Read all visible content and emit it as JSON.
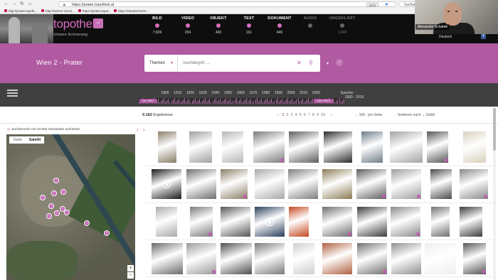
{
  "browser": {
    "url": "https://prater.topothek.at",
    "zoom": "110%",
    "search_placeholder": "Suchen",
    "bookmarks": [
      "http://prater.topoth...",
      "http://wiener-neust...",
      "https://prater.topot...",
      "https://haustechnen..."
    ]
  },
  "webcam": {
    "name": "Alexander Schatek"
  },
  "site": {
    "brand": "topothek",
    "tagline": "Unsere Erinnerung",
    "language": "Deutsch",
    "categories": [
      {
        "label": "BILD",
        "count": "7.826",
        "active": true
      },
      {
        "label": "VIDEO",
        "count": "254",
        "active": true
      },
      {
        "label": "OBJEKT",
        "count": "490",
        "active": true
      },
      {
        "label": "TEXT",
        "count": "161",
        "active": true
      },
      {
        "label": "DOKUMENT",
        "count": "449",
        "active": true
      },
      {
        "label": "AUDIO",
        "count": "-",
        "active": false
      },
      {
        "label": "UNGEKLÄRT",
        "count": "1.240",
        "active": false
      }
    ]
  },
  "search": {
    "district": "Wien 2 - Prater",
    "themen_label": "Themen",
    "placeholder": "Suchbegriff, ..."
  },
  "timeline": {
    "years": [
      "1900",
      "1910",
      "1920",
      "1930",
      "1940",
      "1950",
      "1960",
      "1970",
      "1980",
      "1990",
      "2000",
      "2010",
      "2020"
    ],
    "vor_label": "vor 1900",
    "nach_label": "nach 2019",
    "epoche_label": "Epoche:",
    "epoche_value": "1900 - 2019"
  },
  "results": {
    "count": "9.182",
    "count_label": "Ergebnisse",
    "pages": [
      "1",
      "2",
      "3",
      "4",
      "5",
      "6",
      "7",
      "8",
      "9",
      "10"
    ],
    "current_page": "1",
    "per_page": "100 · pro Seite",
    "sort": "Sortieren nach",
    "sort_value": "Zufall"
  },
  "map": {
    "hint": "Suchbereich mit rechter Maustaste aufziehen",
    "toggle_karte": "Karte",
    "toggle_satellit": "Satellit",
    "markers": [
      "2",
      "3",
      "4",
      "5",
      "2",
      "2",
      "3",
      "4",
      "2",
      "3",
      "2"
    ]
  },
  "colors": {
    "brand_pink": "#b05aa2",
    "header_black": "#0e0e0e",
    "timebar_gray": "#404040"
  }
}
